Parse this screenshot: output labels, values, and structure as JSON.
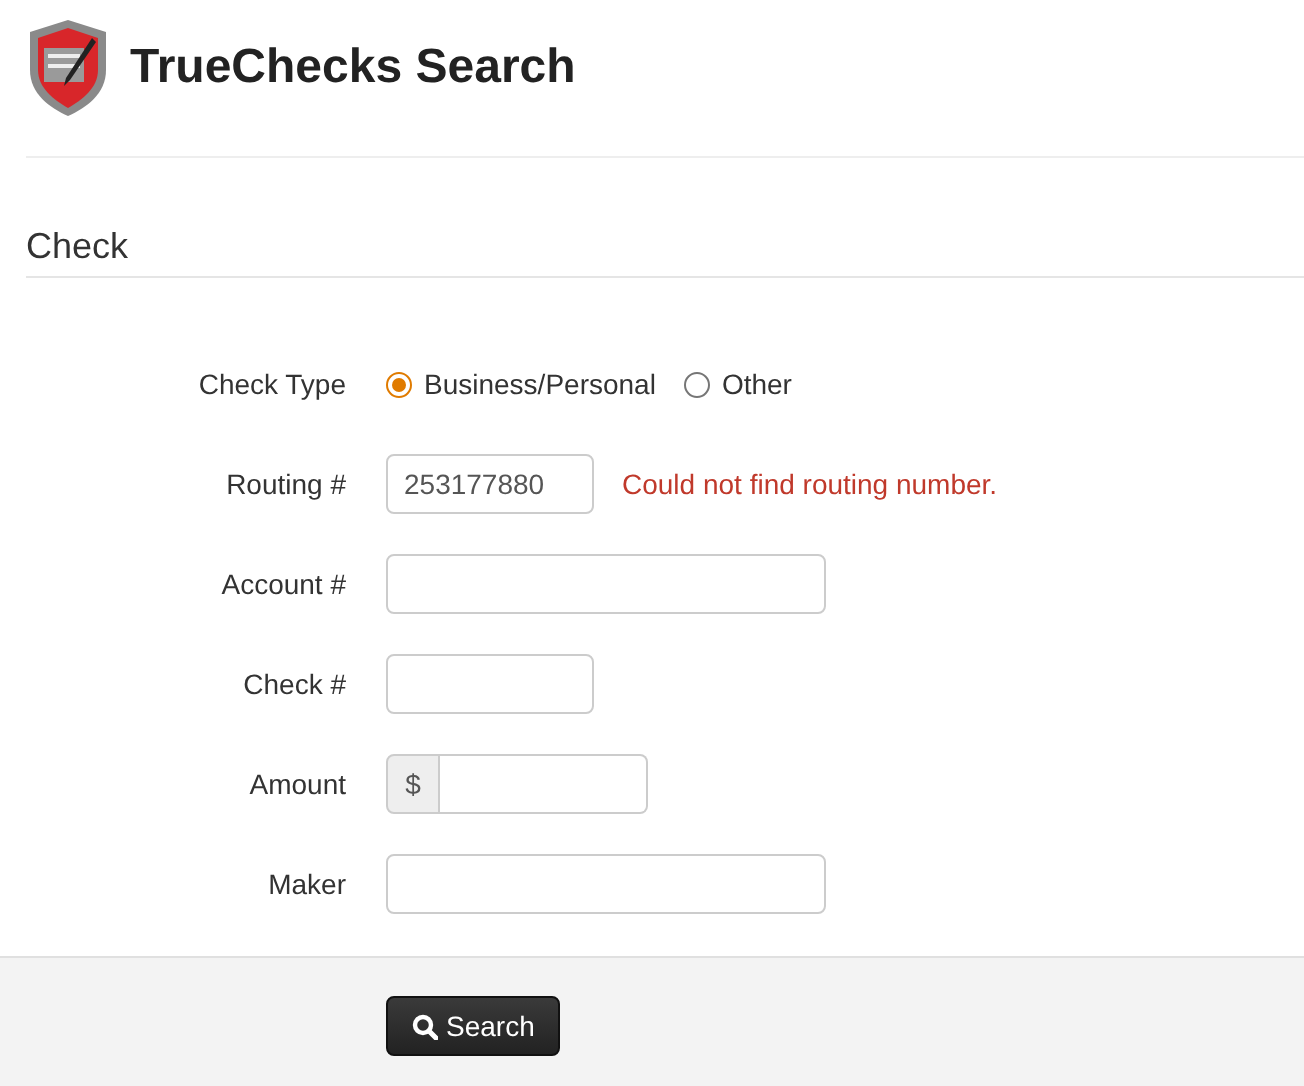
{
  "header": {
    "title": "TrueChecks Search"
  },
  "section": {
    "title": "Check"
  },
  "fields": [
    {
      "kind": "radio",
      "label": "Check Type",
      "options": [
        {
          "label": "Business/Personal",
          "selected": true
        },
        {
          "label": "Other",
          "selected": false
        }
      ]
    },
    {
      "kind": "narrow",
      "label": "Routing #",
      "value": "253177880",
      "error": "Could not find routing number."
    },
    {
      "kind": "wide",
      "label": "Account #"
    },
    {
      "kind": "narrow",
      "label": "Check #"
    },
    {
      "kind": "prefix",
      "label": "Amount",
      "prefix": "$"
    },
    {
      "kind": "wide",
      "label": "Maker"
    }
  ],
  "actions": {
    "button": "Search"
  }
}
